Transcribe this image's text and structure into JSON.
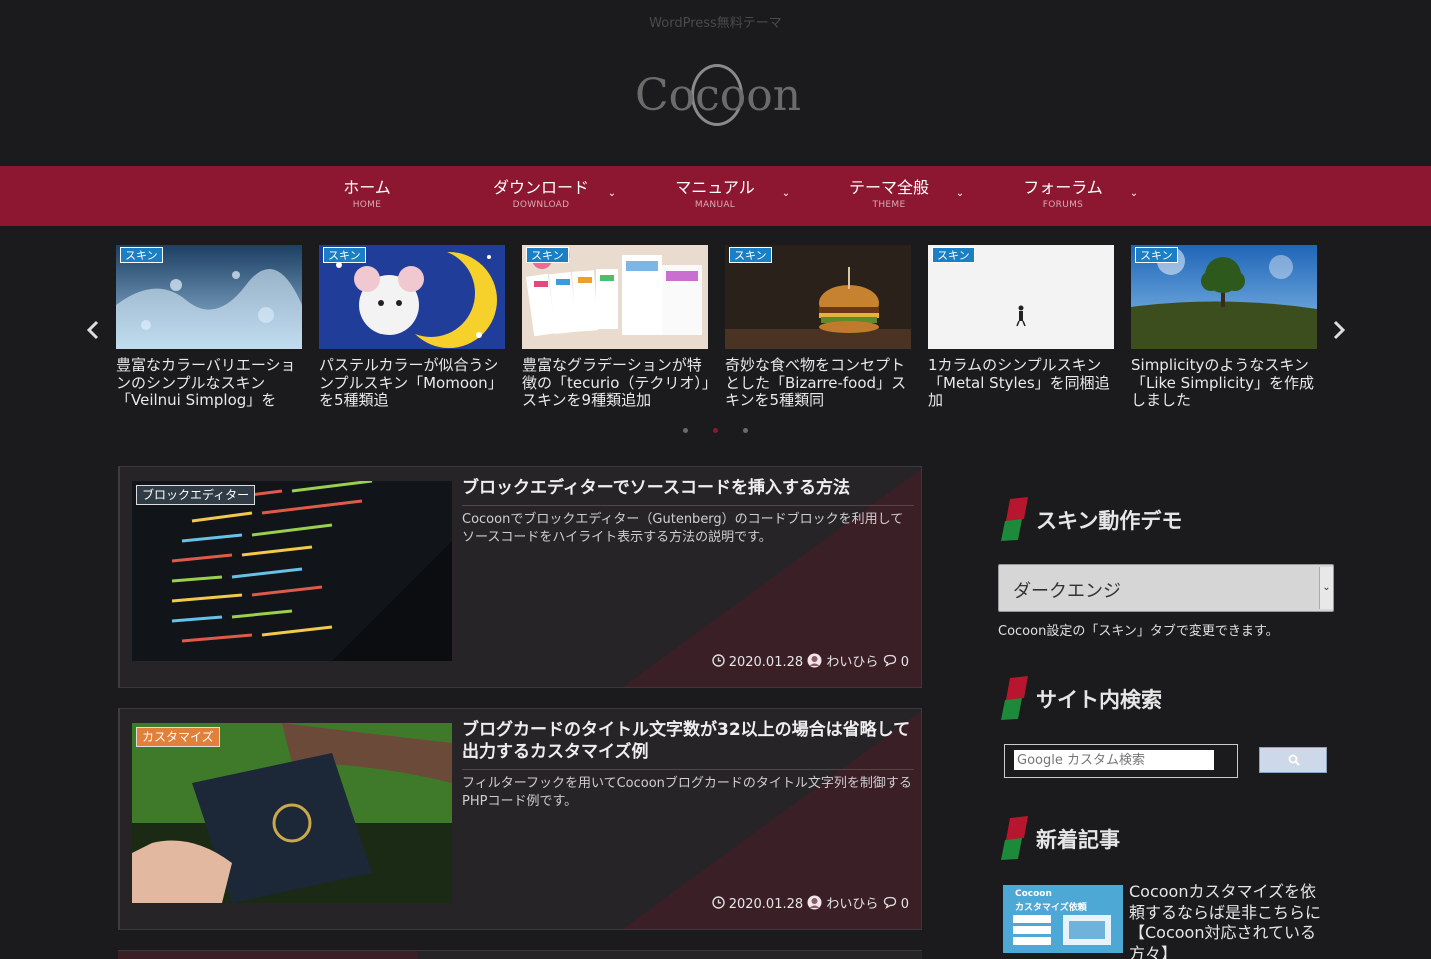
{
  "site": {
    "tagline": "WordPress無料テーマ",
    "logo_text": "Cocoon"
  },
  "nav": {
    "items": [
      {
        "label": "ホーム",
        "sub": "HOME",
        "caret": ""
      },
      {
        "label": "ダウンロード",
        "sub": "DOWNLOAD",
        "caret": "⌄"
      },
      {
        "label": "マニュアル",
        "sub": "MANUAL",
        "caret": "⌄"
      },
      {
        "label": "テーマ全般",
        "sub": "THEME",
        "caret": "⌄"
      },
      {
        "label": "フォーラム",
        "sub": "FORUMS",
        "caret": "⌄"
      }
    ]
  },
  "carousel": {
    "prev_icon": "‹",
    "next_icon": "›",
    "badge": "スキン",
    "slides": [
      {
        "badge": "スキン",
        "title": "豊富なカラーバリエーションのシンプルなスキン「Veilnui Simplog」を"
      },
      {
        "badge": "スキン",
        "title": "パステルカラーが似合うシンプルスキン「Momoon」を5種類追"
      },
      {
        "badge": "スキン",
        "title": "豊富なグラデーションが特徴の「tecurio（テクリオ）」スキンを9種類追加"
      },
      {
        "badge": "スキン",
        "title": "奇妙な食べ物をコンセプトとした「Bizarre-food」スキンを5種類同"
      },
      {
        "badge": "スキン",
        "title": "1カラムのシンプルスキン「Metal Styles」を同梱追加"
      },
      {
        "badge": "スキン",
        "title": "Simplicityのようなスキン「Like Simplicity」を作成しました"
      }
    ],
    "active_dot": 1
  },
  "posts": [
    {
      "category": "ブロックエディター",
      "category_color": "#2f3b45",
      "title": "ブロックエディターでソースコードを挿入する方法",
      "excerpt": "Cocoonでブロックエディター（Gutenberg）のコードブロックを利用してソースコードをハイライト表示する方法の説明です。",
      "date": "2020.01.28",
      "author": "わいひら",
      "comments": "0"
    },
    {
      "category": "カスタマイズ",
      "category_color": "#e0803a",
      "title": "ブログカードのタイトル文字数が32以上の場合は省略して出力するカスタマイズ例",
      "excerpt": "フィルターフックを用いてCocoonブログカードのタイトル文字列を制御するPHPコード例です。",
      "date": "2020.01.28",
      "author": "わいひら",
      "comments": "0"
    }
  ],
  "sidebar": {
    "skin_demo": {
      "heading": "スキン動作デモ",
      "selected": "ダークエンジ",
      "note": "Cocoon設定の「スキン」タブで変更できます。"
    },
    "search": {
      "heading": "サイト内検索",
      "placeholder": "Google カスタム検索"
    },
    "new_posts": {
      "heading": "新着記事",
      "items": [
        {
          "title": "Cocoonカスタマイズを依頼するならば是非こちらに【Cocoon対応されている方々】",
          "thumb_title": "Cocoon",
          "thumb_sub": "カスタマイズ依頼"
        }
      ]
    }
  },
  "colors": {
    "accent": "#8d1630",
    "background": "#1b1a1c",
    "card": "#262427",
    "slide_badge": "#1a7fc4"
  }
}
